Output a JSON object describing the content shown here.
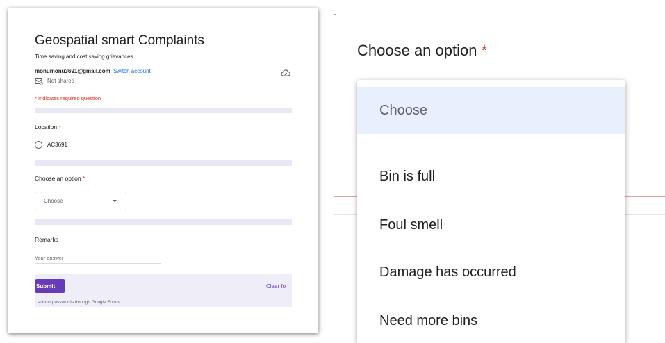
{
  "form": {
    "title": "Geospatial smart Complaints",
    "description": "Time saving and cost saving grievances",
    "account_email": "monumonu3691@gmail.com",
    "switch_account": "Switch account",
    "not_shared": "Not shared",
    "required_note": "* Indicates required question",
    "questions": {
      "location": {
        "label": "Location",
        "required_mark": "*",
        "option": "AC3691"
      },
      "choose_option": {
        "label": "Choose an option",
        "required_mark": "*",
        "dropdown_value": "Choose"
      },
      "remarks": {
        "label": "Remarks",
        "placeholder": "Your answer"
      }
    },
    "submit_label": "Submit",
    "clear_label": "Clear fo",
    "footer_note": "r submit passwords through Google Forms."
  },
  "zoom": {
    "question": "Choose an option",
    "required_mark": "*",
    "selected_option": "Choose",
    "options": [
      "Bin is full",
      "Foul smell",
      "Damage has occurred",
      "Need more bins"
    ]
  },
  "colors": {
    "accent": "#673ab7",
    "required": "#d93025",
    "link": "#1a73e8",
    "selected_option_bg": "#e8f0fe",
    "section_band": "#e8e7f4"
  },
  "icons": [
    "cloud-icon",
    "not-shared-icon",
    "chevron-down-icon"
  ]
}
